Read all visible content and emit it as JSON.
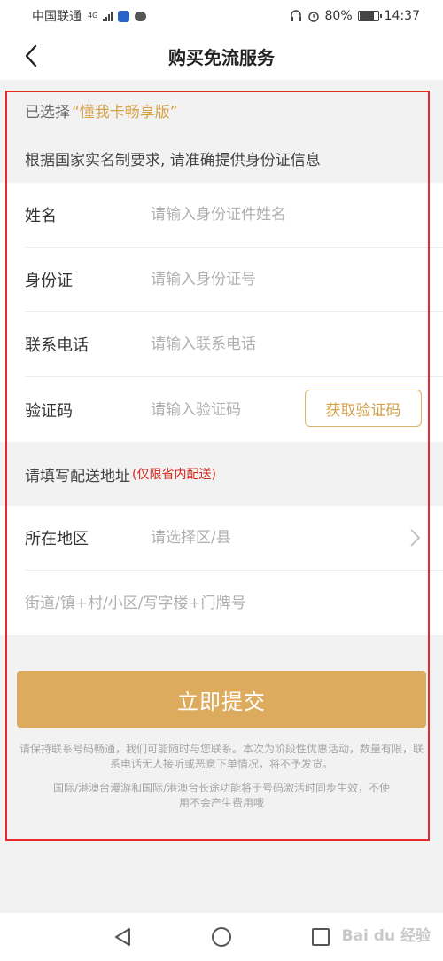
{
  "status_bar": {
    "carrier": "中国联通",
    "network_tag": "4G",
    "battery_percent": "80%",
    "time": "14:37"
  },
  "header": {
    "title": "购买免流服务"
  },
  "selection": {
    "prefix": "已选择",
    "product_name": "“懂我卡畅享版”"
  },
  "notice": "根据国家实名制要求, 请准确提供身份证信息",
  "form": {
    "name": {
      "label": "姓名",
      "placeholder": "请输入身份证件姓名"
    },
    "id_card": {
      "label": "身份证",
      "placeholder": "请输入身份证号"
    },
    "phone": {
      "label": "联系电话",
      "placeholder": "请输入联系电话"
    },
    "code": {
      "label": "验证码",
      "placeholder": "请输入验证码",
      "button": "获取验证码"
    }
  },
  "address": {
    "header": "请填写配送地址",
    "note": "(仅限省内配送)",
    "region": {
      "label": "所在地区",
      "placeholder": "请选择区/县"
    },
    "street_placeholder": "街道/镇+村/小区/写字楼+门牌号"
  },
  "submit_label": "立即提交",
  "tips": {
    "line1": "请保持联系号码畅通，我们可能随时与您联系。本次为阶段性优惠活动，数量有限，联系电话无人接听或恶意下单情况，将不予发货。",
    "line2": "国际/港澳台漫游和国际/港澳台长途功能将于号码激活时同步生效，不使用不会产生费用哦"
  },
  "watermark": "Bai du 经验",
  "colors": {
    "accent": "#dcab5e",
    "accent_text": "#d4a24a",
    "warning": "#d9261c",
    "annotation_frame": "#e52b2b"
  }
}
